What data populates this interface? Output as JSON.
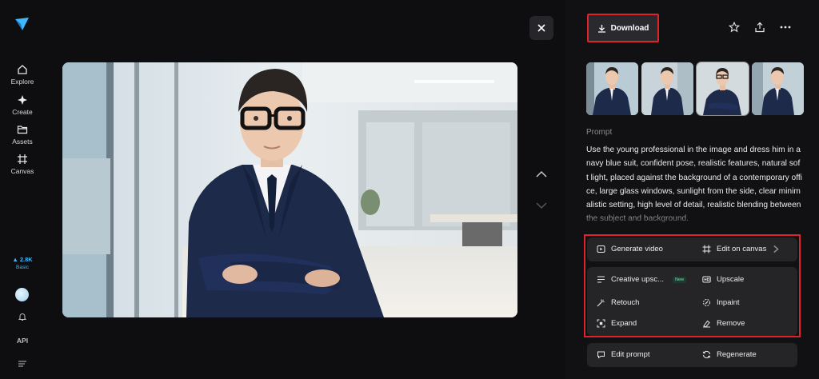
{
  "sidebar": {
    "nav": [
      {
        "label": "Explore",
        "icon": "home-icon"
      },
      {
        "label": "Create",
        "icon": "sparkle-icon"
      },
      {
        "label": "Assets",
        "icon": "folder-icon"
      },
      {
        "label": "Canvas",
        "icon": "canvas-icon"
      }
    ],
    "credits": "2.8K",
    "plan": "Basic",
    "api_label": "API"
  },
  "panel": {
    "download_label": "Download",
    "prompt_label": "Prompt",
    "prompt_text": "Use the young professional in the image and dress him in a navy blue suit, confident pose, realistic features, natural soft light, placed against the background of a contemporary office, large glass windows, sunlight from the side, clear minimalistic setting, high level of detail, realistic blending between the subject and background.",
    "actions": {
      "generate_video": "Generate video",
      "edit_on_canvas": "Edit on canvas",
      "creative_upscale": "Creative upsc...",
      "new_badge": "New",
      "upscale": "Upscale",
      "retouch": "Retouch",
      "inpaint": "Inpaint",
      "expand": "Expand",
      "remove": "Remove",
      "edit_prompt": "Edit prompt",
      "regenerate": "Regenerate"
    }
  },
  "colors": {
    "accent_blue": "#3fb8ff",
    "highlight_red": "#e0232b",
    "background": "#0e0e10"
  }
}
